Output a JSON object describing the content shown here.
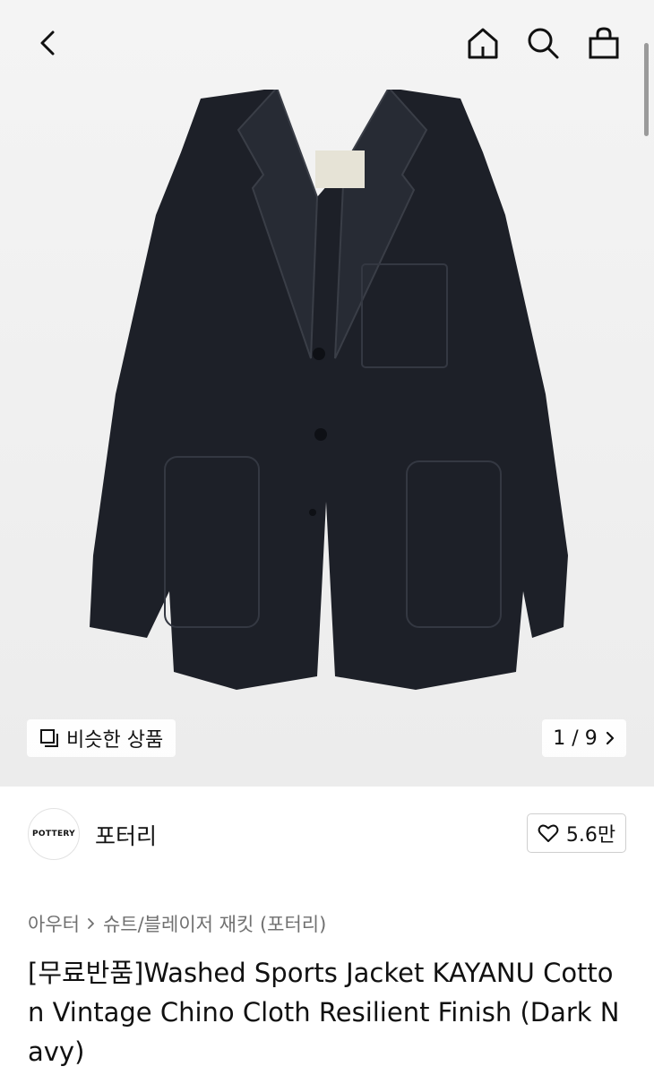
{
  "header": {
    "back_icon": "chevron-left-icon",
    "home_icon": "home-icon",
    "search_icon": "search-icon",
    "cart_icon": "shopping-bag-icon"
  },
  "gallery": {
    "image_alt": "Dark navy sports jacket",
    "similar_label": "비슷한 상품",
    "pager_text": "1 / 9"
  },
  "brand": {
    "logo_text": "POTTERY",
    "name": "포터리",
    "like_count": "5.6만"
  },
  "breadcrumb": {
    "level1": "아우터",
    "level2": "슈트/블레이저 재킷 (포터리)"
  },
  "product": {
    "title": "[무료반품]Washed Sports Jacket KAYANU Cotton Vintage Chino Cloth Resilient Finish (Dark Navy)"
  },
  "colors": {
    "jacket": "#1d2028",
    "background": "#efefef"
  }
}
